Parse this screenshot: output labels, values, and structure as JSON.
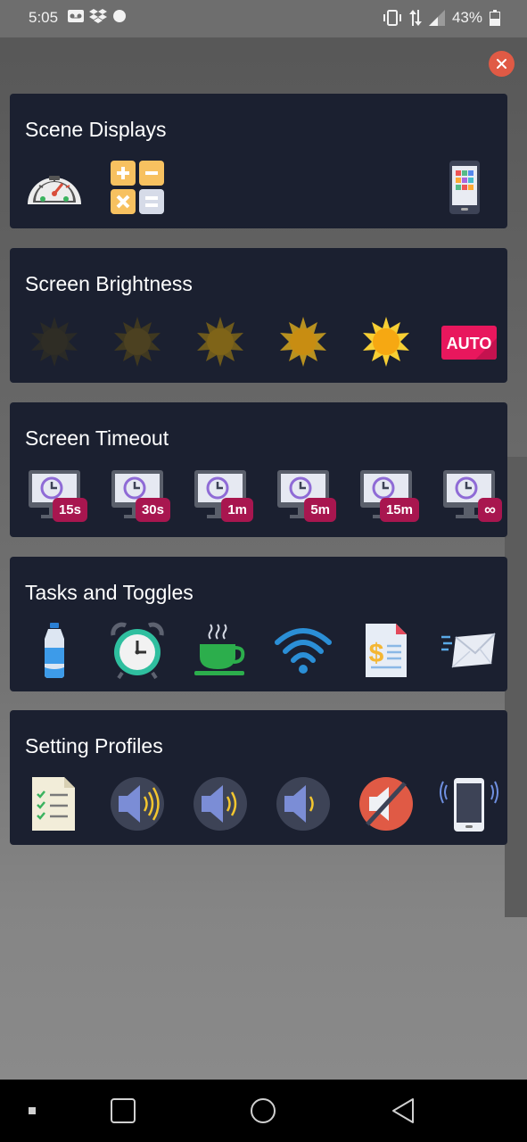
{
  "status_bar": {
    "time": "5:05",
    "battery": "43%",
    "icons": [
      "voicemail-icon",
      "dropbox-icon",
      "dot-icon",
      "vibrate-icon",
      "data-arrows-icon",
      "signal-icon",
      "battery-icon"
    ]
  },
  "cards": [
    {
      "title": "Scene Displays",
      "tiles": [
        {
          "icon": "speedometer-icon"
        },
        {
          "icon": "calculator-icon"
        },
        {
          "icon": "phone-apps-icon"
        }
      ]
    },
    {
      "title": "Screen Brightness",
      "tiles": [
        {
          "icon": "sun-level-1-icon"
        },
        {
          "icon": "sun-level-2-icon"
        },
        {
          "icon": "sun-level-3-icon"
        },
        {
          "icon": "sun-level-4-icon"
        },
        {
          "icon": "sun-level-5-icon"
        },
        {
          "icon": "auto-brightness-icon",
          "label": "AUTO"
        }
      ]
    },
    {
      "title": "Screen Timeout",
      "tiles": [
        {
          "icon": "monitor-clock-icon",
          "badge": "15s"
        },
        {
          "icon": "monitor-clock-icon",
          "badge": "30s"
        },
        {
          "icon": "monitor-clock-icon",
          "badge": "1m"
        },
        {
          "icon": "monitor-clock-icon",
          "badge": "5m"
        },
        {
          "icon": "monitor-clock-icon",
          "badge": "15m"
        },
        {
          "icon": "monitor-clock-icon",
          "badge": "∞"
        }
      ]
    },
    {
      "title": "Tasks and Toggles",
      "tiles": [
        {
          "icon": "water-bottle-icon"
        },
        {
          "icon": "alarm-clock-icon"
        },
        {
          "icon": "coffee-cup-icon"
        },
        {
          "icon": "wifi-icon"
        },
        {
          "icon": "invoice-document-icon"
        },
        {
          "icon": "mail-send-icon"
        }
      ]
    },
    {
      "title": "Setting Profiles",
      "tiles": [
        {
          "icon": "checklist-icon"
        },
        {
          "icon": "volume-high-icon"
        },
        {
          "icon": "volume-medium-icon"
        },
        {
          "icon": "volume-low-icon"
        },
        {
          "icon": "mute-icon"
        },
        {
          "icon": "vibrate-phone-icon"
        }
      ]
    }
  ],
  "colors": {
    "card_bg": "#1b2030",
    "close_red": "#e05a45",
    "badge": "#a8164f",
    "auto_pink": "#e8175d"
  }
}
